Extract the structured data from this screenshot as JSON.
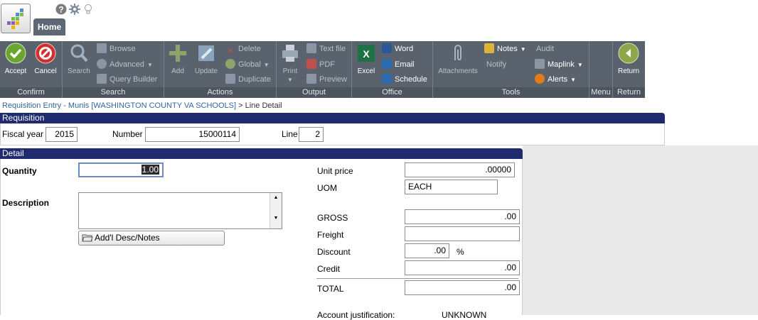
{
  "toolbar_top": {
    "help_icon": "question-circle-icon",
    "settings_icon": "gear-icon",
    "tip_icon": "lightbulb-icon"
  },
  "tabs": {
    "home": "Home"
  },
  "ribbon": {
    "confirm": {
      "label": "Confirm",
      "accept": "Accept",
      "cancel": "Cancel"
    },
    "search": {
      "label": "Search",
      "search": "Search",
      "browse": "Browse",
      "advanced": "Advanced",
      "query_builder": "Query Builder"
    },
    "actions": {
      "label": "Actions",
      "add": "Add",
      "update": "Update",
      "delete": "Delete",
      "global": "Global",
      "duplicate": "Duplicate"
    },
    "output": {
      "label": "Output",
      "print": "Print",
      "text_file": "Text file",
      "pdf": "PDF",
      "preview": "Preview"
    },
    "office": {
      "label": "Office",
      "excel": "Excel",
      "word": "Word",
      "email": "Email",
      "schedule": "Schedule"
    },
    "tools": {
      "label": "Tools",
      "attachments": "Attachments",
      "notes": "Notes",
      "notify": "Notify",
      "audit": "Audit",
      "maplink": "Maplink",
      "alerts": "Alerts"
    },
    "menu": {
      "label": "Menu"
    },
    "return": {
      "label": "Return",
      "return": "Return"
    }
  },
  "breadcrumb": {
    "link": "Requisition Entry - Munis [WASHINGTON COUNTY VA SCHOOLS]",
    "sep": ">",
    "current": "Line Detail"
  },
  "requisition": {
    "header": "Requisition",
    "fiscal_year_label": "Fiscal year",
    "fiscal_year": "2015",
    "number_label": "Number",
    "number": "15000114",
    "line_label": "Line",
    "line": "2"
  },
  "detail": {
    "header": "Detail",
    "quantity_label": "Quantity",
    "quantity": "1.00",
    "description_label": "Description",
    "description": "",
    "add_desc_button": "Add'l Desc/Notes",
    "unit_price_label": "Unit price",
    "unit_price": ".00000",
    "uom_label": "UOM",
    "uom": "EACH",
    "gross_label": "GROSS",
    "gross": ".00",
    "freight_label": "Freight",
    "freight": "",
    "discount_label": "Discount",
    "discount": ".00",
    "discount_unit": "%",
    "credit_label": "Credit",
    "credit": ".00",
    "total_label": "TOTAL",
    "total": ".00",
    "account_justification_label": "Account justification:",
    "account_justification": "UNKNOWN"
  },
  "colors": {
    "ribbon": "#5a636d",
    "panel_header": "#1f2a6f",
    "accept": "#6aa52f",
    "cancel": "#d32f2f"
  }
}
